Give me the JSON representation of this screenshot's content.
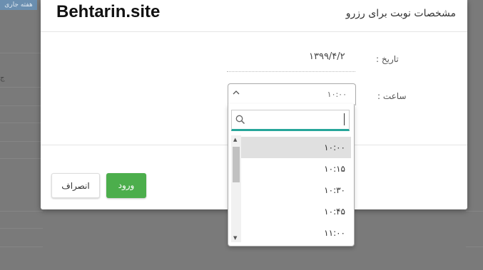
{
  "background": {
    "tab_label": "هفته جاری",
    "side_char": "ج"
  },
  "modal": {
    "brand": "Behtarin.site",
    "title": "مشخصات نوبت برای رزرو",
    "date_label": "تاریخ :",
    "date_value": "۱۳۹۹/۴/۲",
    "time_label": "ساعت :",
    "time_selected": "۱۰:۰۰",
    "enter_button": "ورود",
    "cancel_button": "انصراف"
  },
  "dropdown": {
    "search_value": "",
    "options": [
      "۱۰:۰۰",
      "۱۰:۱۵",
      "۱۰:۳۰",
      "۱۰:۴۵",
      "۱۱:۰۰"
    ],
    "highlighted_index": 0
  },
  "colors": {
    "primary_button": "#4cae4c",
    "search_underline": "#26a69a"
  }
}
